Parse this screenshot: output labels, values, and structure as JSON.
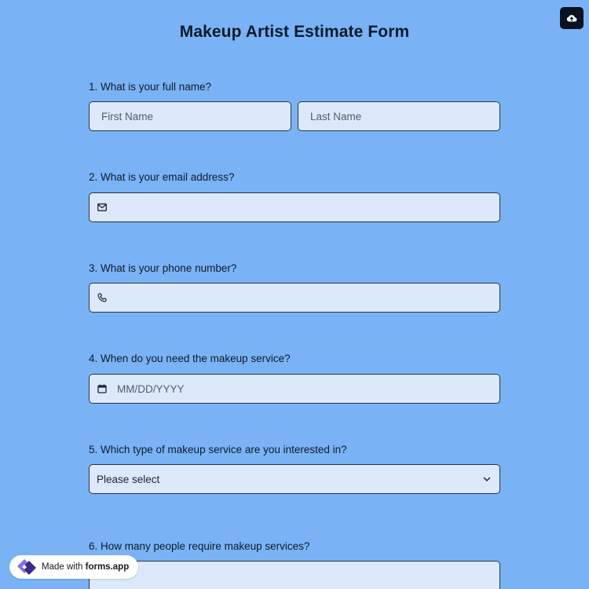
{
  "form": {
    "title": "Makeup Artist Estimate Form",
    "upload_icon": "cloud-upload-icon"
  },
  "questions": [
    {
      "label": "1.  What is your full name?",
      "first_placeholder": "First Name",
      "last_placeholder": "Last Name"
    },
    {
      "label": "2.  What is your email address?",
      "icon": "mail-icon"
    },
    {
      "label": "3.  What is your phone number?",
      "icon": "phone-icon"
    },
    {
      "label": "4.  When do you need the makeup service?",
      "icon": "calendar-icon",
      "placeholder": "MM/DD/YYYY"
    },
    {
      "label": "5.  Which type of makeup service are you interested in?",
      "selected": "Please select",
      "icon": "chevron-down-icon"
    },
    {
      "label": "6.  How many people require makeup services?"
    }
  ],
  "badge": {
    "prefix": "Made with",
    "brand": "forms.app"
  },
  "colors": {
    "background": "#7ab3f5",
    "field": "#dbe9fb",
    "border": "#24344a",
    "button": "#0b1220"
  }
}
